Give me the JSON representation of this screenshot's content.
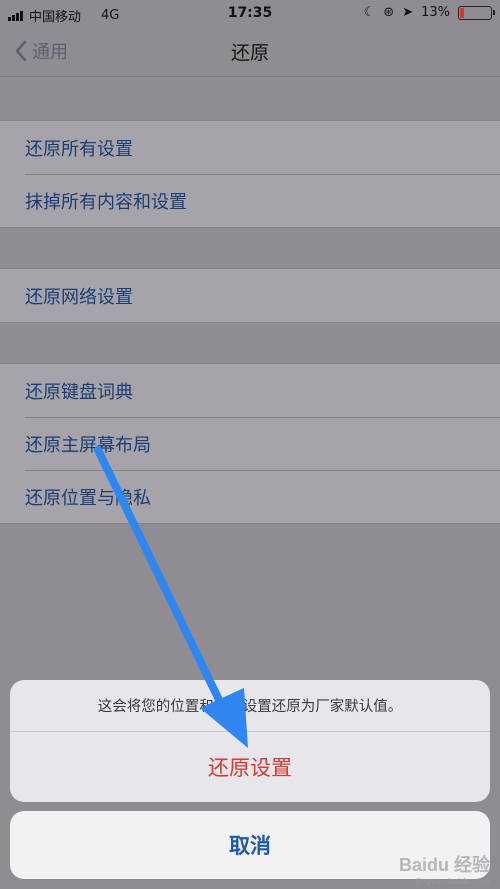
{
  "status_bar": {
    "carrier": "中国移动",
    "network": "4G",
    "time": "17:35",
    "battery": "13%",
    "battery_level": 0.13,
    "icons": [
      "signal-bars-icon",
      "moon-icon",
      "rotation-lock-icon",
      "location-arrow-icon",
      "battery-icon"
    ]
  },
  "nav": {
    "back_label": "通用",
    "title": "还原"
  },
  "groups": [
    {
      "items": [
        "还原所有设置",
        "抹掉所有内容和设置"
      ]
    },
    {
      "items": [
        "还原网络设置"
      ]
    },
    {
      "items": [
        "还原键盘词典",
        "还原主屏幕布局",
        "还原位置与隐私"
      ]
    }
  ],
  "action_sheet": {
    "message": "这会将您的位置和隐私设置还原为厂家默认值。",
    "destructive_label": "还原设置",
    "cancel_label": "取消"
  },
  "watermark": {
    "logo": "Baidu 经验",
    "url": "jingyan.baidu.com"
  },
  "colors": {
    "accent": "#1f5aa8",
    "destructive": "#d63a33",
    "annotation_arrow": "#2f86f0"
  }
}
